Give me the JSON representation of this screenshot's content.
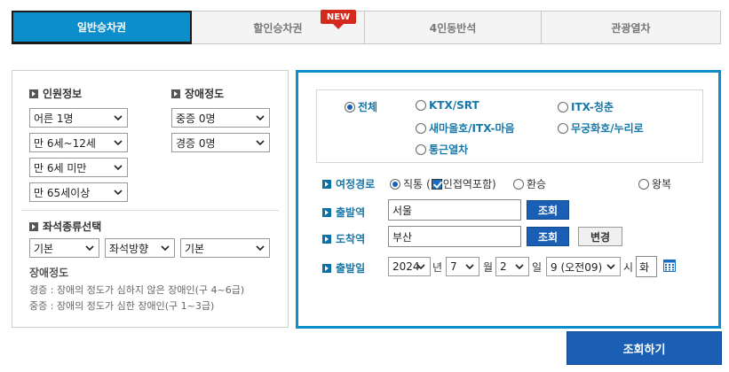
{
  "tabs": [
    {
      "label": "일반승차권",
      "active": true
    },
    {
      "label": "할인승차권",
      "badge": "NEW"
    },
    {
      "label": "4인동반석"
    },
    {
      "label": "관광열차"
    }
  ],
  "passengers": {
    "title": "인원정보",
    "selects": [
      "어른 1명",
      "만 6세~12세",
      "만 6세 미만",
      "만 65세이상"
    ]
  },
  "disability": {
    "title": "장애정도",
    "selects": [
      "중증 0명",
      "경증 0명"
    ]
  },
  "seat_type": {
    "title": "좌석종류선택",
    "selects": [
      "기본",
      "좌석방향",
      "기본"
    ]
  },
  "disability_note": {
    "title": "장애정도",
    "lines": [
      "경증 : 장애의 정도가 심하지 않은 장애인(구 4~6급)",
      "중증 : 장애의 정도가 심한 장애인(구 1~3급)"
    ]
  },
  "train_types": {
    "options": [
      "전체",
      "KTX/SRT",
      "ITX-청춘",
      "새마을호/ITX-마음",
      "무궁화호/누리로",
      "통근열차"
    ],
    "selected": "전체"
  },
  "route": {
    "label": "여정경로",
    "options": [
      "직통",
      "인접역포함",
      "환승",
      "왕복"
    ],
    "direct_selected": true,
    "nearby_checked": true
  },
  "departure": {
    "label": "출발역",
    "value": "서울",
    "search_label": "조회"
  },
  "arrival": {
    "label": "도착역",
    "value": "부산",
    "search_label": "조회",
    "swap_label": "변경"
  },
  "date": {
    "label": "출발일",
    "year": "2024",
    "year_unit": "년",
    "month": "7",
    "month_unit": "월",
    "day": "2",
    "day_unit": "일",
    "hour": "9 (오전09)",
    "hour_unit": "시",
    "weekday": "화"
  },
  "submit_label": "조회하기",
  "colors": {
    "accent": "#0b8ec9",
    "button": "#1a5fb4",
    "badge": "#d42a1e"
  },
  "icons": [
    "chevron-down-icon",
    "calendar-icon",
    "bullet-arrow-icon"
  ]
}
